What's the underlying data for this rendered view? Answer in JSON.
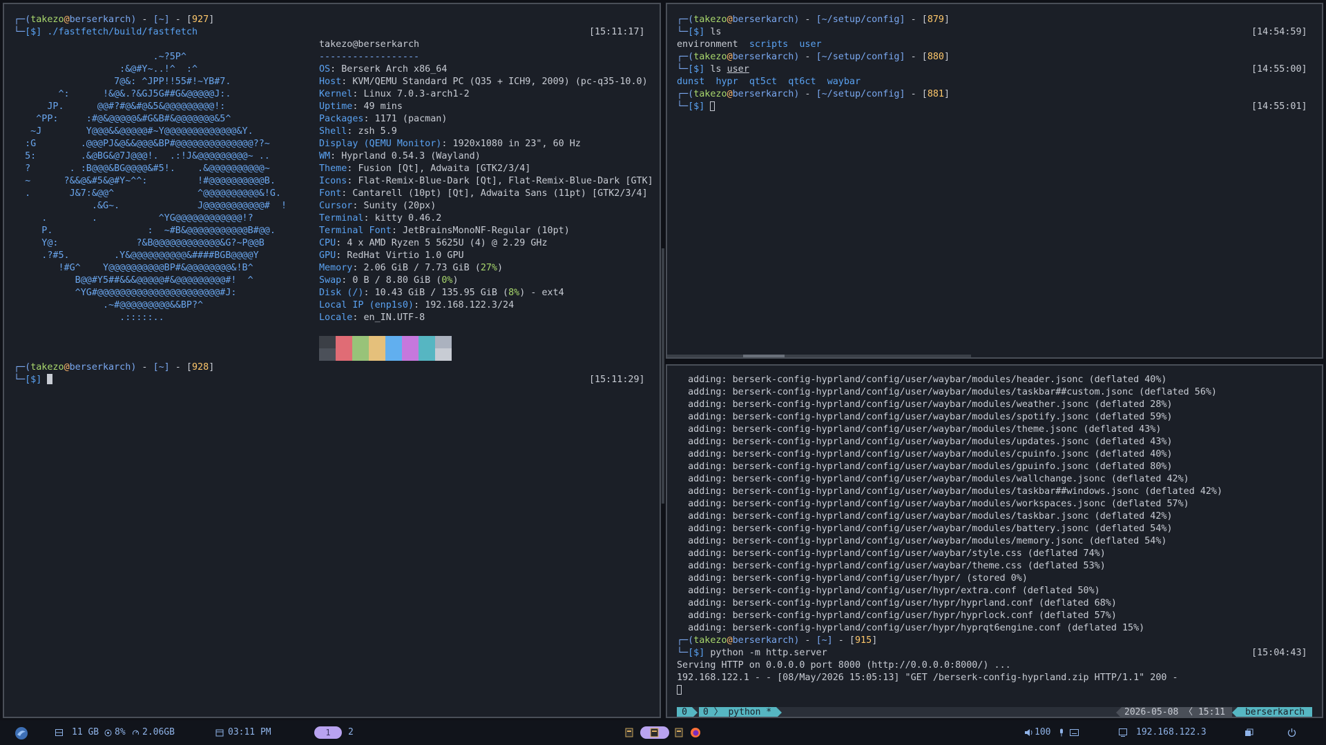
{
  "prompt": {
    "user": "takezo",
    "at": "@",
    "host": "berserkarch",
    "sep": " - ",
    "dollar": "[$]"
  },
  "left": {
    "p1": {
      "path": "[~]",
      "num": "927",
      "cmd": "./fastfetch/build/fastfetch",
      "time": "[15:11:17]"
    },
    "p2": {
      "path": "[~]",
      "num": "928",
      "time": "[15:11:29]"
    },
    "logo": [
      "                                                        .",
      "                         .~?5P^",
      "                   :&@#Y~..!^  :^",
      "                  7@&: ^JPP!!55#!~YB#7.",
      "        ^:      !&@&.?&GJ5G##G&@@@@@J:.",
      "      JP.      @@#?#@&#@&5&@@@@@@@@@!:",
      "    ^PP:     :#@&@@@@@&#G&B#&@@@@@@@&5^",
      "   ~J        Y@@@&&@@@@@#~Y@@@@@@@@@@@@@&Y.",
      "  :G        .@@@PJ&@&&@@@&BP#@@@@@@@@@@@@@@??~",
      "  5:        .&@BG&@7J@@@!.  .:!J&@@@@@@@@@~ ..",
      "  ?       . :B@@@&BG@@@@&#5!.    .&@@@@@@@@@@~",
      "  ~      ?&&@&#5&@#Y~^^:         !#@@@@@@@@@@B.",
      "  .       J&7:&@@^               ^@@@@@@@@@@&!G.",
      "              .&G~.              J@@@@@@@@@@@#  !",
      "     .        .           ^YG@@@@@@@@@@@@!?",
      "     P.                 :  ~#B&@@@@@@@@@@@B#@@.",
      "     Y@:              ?&B@@@@@@@@@@@@&G?~P@@B",
      "     .?#5.        .Y&@@@@@@@@@@&####BGB@@@@Y",
      "        !#G^    Y@@@@@@@@@@BP#&@@@@@@@@&!B^",
      "           B@@#Y5##&&&@@@@@#&@@@@@@@@@#!  ^",
      "           ^YG#@@@@@@@@@@@@@@@@@@@@@@#J:",
      "                .~#@@@@@@@@@&&BP?^",
      "                   .:::::.."
    ],
    "info_title": "takezo@berserkarch",
    "info_sep": "------------------",
    "info": [
      {
        "k": "OS",
        "v": "Berserk Arch x86_64"
      },
      {
        "k": "Host",
        "v": "KVM/QEMU Standard PC (Q35 + ICH9, 2009) (pc-q35-10.0)"
      },
      {
        "k": "Kernel",
        "v": "Linux 7.0.3-arch1-2"
      },
      {
        "k": "Uptime",
        "v": "49 mins"
      },
      {
        "k": "Packages",
        "v": "1171 (pacman)"
      },
      {
        "k": "Shell",
        "v": "zsh 5.9"
      },
      {
        "k": "Display (QEMU Monitor)",
        "v": "1920x1080 in 23\", 60 Hz"
      },
      {
        "k": "WM",
        "v": "Hyprland 0.54.3 (Wayland)"
      },
      {
        "k": "Theme",
        "v": "Fusion [Qt], Adwaita [GTK2/3/4]"
      },
      {
        "k": "Icons",
        "v": "Flat-Remix-Blue-Dark [Qt], Flat-Remix-Blue-Dark [GTK]"
      },
      {
        "k": "Font",
        "v": "Cantarell (10pt) [Qt], Adwaita Sans (11pt) [GTK2/3/4]"
      },
      {
        "k": "Cursor",
        "v": "Sunity (20px)"
      },
      {
        "k": "Terminal",
        "v": "kitty 0.46.2"
      },
      {
        "k": "Terminal Font",
        "v": "JetBrainsMonoNF-Regular (10pt)"
      },
      {
        "k": "CPU",
        "v": "4 x AMD Ryzen 5 5625U (4) @ 2.29 GHz"
      },
      {
        "k": "GPU",
        "v": "RedHat Virtio 1.0 GPU"
      },
      {
        "k": "Memory",
        "v": "2.06 GiB / 7.73 GiB (",
        "p": "27%",
        "s": ")"
      },
      {
        "k": "Swap",
        "v": "0 B / 8.80 GiB (",
        "p": "0%",
        "s": ")"
      },
      {
        "k": "Disk (/)",
        "v": "10.43 GiB / 135.95 GiB (",
        "p": "8%",
        "s": ") - ext4"
      },
      {
        "k": "Local IP (enp1s0)",
        "v": "192.168.122.3/24"
      },
      {
        "k": "Locale",
        "v": "en_IN.UTF-8"
      }
    ],
    "palette_dark": [
      "#3b3f46",
      "#e06c75",
      "#98c379",
      "#e5c07b",
      "#61afef",
      "#c678dd",
      "#56b6c2",
      "#abb2bf"
    ],
    "palette_light": [
      "#4b5059",
      "#e06c75",
      "#98c379",
      "#e5c07b",
      "#61afef",
      "#c678dd",
      "#56b6c2",
      "#c8ccd4"
    ]
  },
  "topright": {
    "p1": {
      "path": "[~/setup/config]",
      "num": "879",
      "cmd": "ls",
      "time": "[14:54:59]"
    },
    "ls1": [
      "environment",
      "scripts",
      "user"
    ],
    "p2": {
      "path": "[~/setup/config]",
      "num": "880",
      "cmd": "ls ",
      "arg": "user",
      "time": "[14:55:00]"
    },
    "ls2": [
      "dunst",
      "hypr",
      "qt5ct",
      "qt6ct",
      "waybar"
    ],
    "p3": {
      "path": "[~/setup/config]",
      "num": "881",
      "time": "[14:55:01]"
    }
  },
  "bottomright": {
    "adding": [
      "  adding: berserk-config-hyprland/config/user/waybar/modules/header.jsonc (deflated 40%)",
      "  adding: berserk-config-hyprland/config/user/waybar/modules/taskbar##custom.jsonc (deflated 56%)",
      "  adding: berserk-config-hyprland/config/user/waybar/modules/weather.jsonc (deflated 28%)",
      "  adding: berserk-config-hyprland/config/user/waybar/modules/spotify.jsonc (deflated 59%)",
      "  adding: berserk-config-hyprland/config/user/waybar/modules/theme.jsonc (deflated 43%)",
      "  adding: berserk-config-hyprland/config/user/waybar/modules/updates.jsonc (deflated 43%)",
      "  adding: berserk-config-hyprland/config/user/waybar/modules/cpuinfo.jsonc (deflated 40%)",
      "  adding: berserk-config-hyprland/config/user/waybar/modules/gpuinfo.jsonc (deflated 80%)",
      "  adding: berserk-config-hyprland/config/user/waybar/modules/wallchange.jsonc (deflated 42%)",
      "  adding: berserk-config-hyprland/config/user/waybar/modules/taskbar##windows.jsonc (deflated 42%)",
      "  adding: berserk-config-hyprland/config/user/waybar/modules/workspaces.jsonc (deflated 57%)",
      "  adding: berserk-config-hyprland/config/user/waybar/modules/taskbar.jsonc (deflated 42%)",
      "  adding: berserk-config-hyprland/config/user/waybar/modules/battery.jsonc (deflated 54%)",
      "  adding: berserk-config-hyprland/config/user/waybar/modules/memory.jsonc (deflated 54%)",
      "  adding: berserk-config-hyprland/config/user/waybar/style.css (deflated 74%)",
      "  adding: berserk-config-hyprland/config/user/waybar/theme.css (deflated 53%)",
      "  adding: berserk-config-hyprland/config/user/hypr/ (stored 0%)",
      "  adding: berserk-config-hyprland/config/user/hypr/extra.conf (deflated 50%)",
      "  adding: berserk-config-hyprland/config/user/hypr/hyprland.conf (deflated 68%)",
      "  adding: berserk-config-hyprland/config/user/hypr/hyprlock.conf (deflated 57%)",
      "  adding: berserk-config-hyprland/config/user/hypr/hyprqt6engine.conf (deflated 15%)"
    ],
    "p1": {
      "path": "[~]",
      "num": "915",
      "cmd": "python -m http.server",
      "time": "[15:04:43]"
    },
    "serving": "Serving HTTP on 0.0.0.0 port 8000 (http://0.0.0.0:8000/) ...",
    "request": "192.168.122.1 - - [08/May/2026 15:05:13] \"GET /berserk-config-hyprland.zip HTTP/1.1\" 200 -",
    "tmux": {
      "session": "0",
      "window_index": "0",
      "window_name": "python *",
      "date": "2026-05-08",
      "time": "15:11",
      "host": "berserkarch"
    }
  },
  "taskbar": {
    "mem": "11 GB",
    "cpu": "8%",
    "swap": "2.06GB",
    "clock": "03:11 PM",
    "ws1": "1",
    "ws2": "2",
    "volume": "100",
    "ip": "192.168.122.3",
    "colors": {
      "accent": "#b9a3f0",
      "text": "#8fb3e8",
      "bg": "#11141b"
    }
  }
}
